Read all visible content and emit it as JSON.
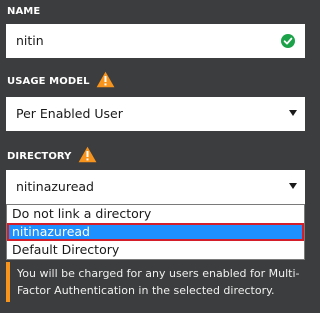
{
  "name": {
    "label": "NAME",
    "value": "nitin"
  },
  "usage_model": {
    "label": "USAGE MODEL",
    "value": "Per Enabled User"
  },
  "directory": {
    "label": "DIRECTORY",
    "value": "nitinazuread",
    "options": [
      "Do not link a directory",
      "nitinazuread",
      "Default Directory"
    ]
  },
  "notice": {
    "text": "You will be charged for any users enabled for Multi-Factor Authentication in the selected directory."
  },
  "colors": {
    "background": "#3c3d3e",
    "warning": "#f7941d",
    "success": "#1ca34a",
    "selection": "#1e90ff",
    "highlight_border": "#d41f2a"
  },
  "icons": {
    "name_status": "checkmark-circle-icon",
    "usage_model_alert": "warning-triangle-icon",
    "directory_alert": "warning-triangle-icon"
  }
}
